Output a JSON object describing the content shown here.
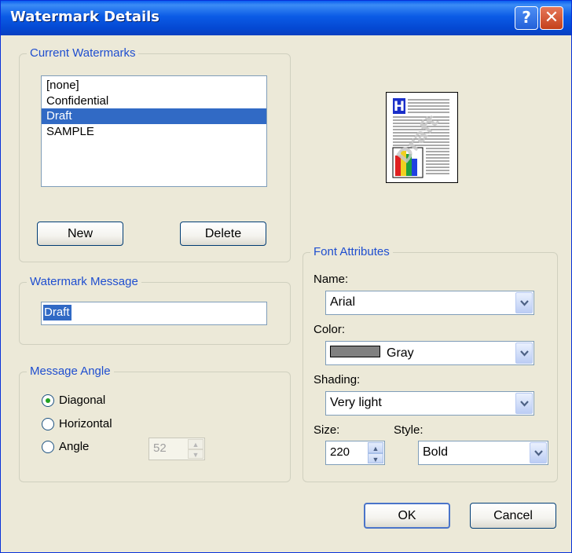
{
  "window": {
    "title": "Watermark Details"
  },
  "current_watermarks": {
    "legend": "Current Watermarks",
    "items": [
      "[none]",
      "Confidential",
      "Draft",
      "SAMPLE"
    ],
    "selected_index": 2,
    "new_label": "New",
    "delete_label": "Delete"
  },
  "preview": {
    "header_letter": "H",
    "watermark_text": "Draft"
  },
  "watermark_message": {
    "legend": "Watermark Message",
    "value": "Draft"
  },
  "message_angle": {
    "legend": "Message Angle",
    "diagonal_label": "Diagonal",
    "horizontal_label": "Horizontal",
    "angle_label": "Angle",
    "selected": "Diagonal",
    "angle_value": "52"
  },
  "font_attributes": {
    "legend": "Font Attributes",
    "name_label": "Name:",
    "name_value": "Arial",
    "color_label": "Color:",
    "color_value": "Gray",
    "color_swatch": "#808080",
    "shading_label": "Shading:",
    "shading_value": "Very light",
    "size_label": "Size:",
    "size_value": "220",
    "style_label": "Style:",
    "style_value": "Bold"
  },
  "footer": {
    "ok_label": "OK",
    "cancel_label": "Cancel"
  },
  "colors": {
    "title_bar": "#0b5be6",
    "legend_text": "#1f4ecf",
    "selection": "#316ac5",
    "dialog_bg": "#ece9d8"
  }
}
